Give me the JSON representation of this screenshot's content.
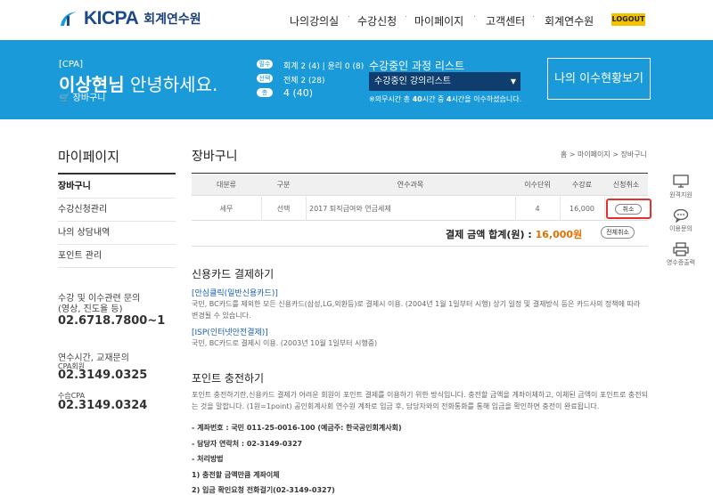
{
  "header": {
    "logo_mark": "KICPA",
    "logo_sub": "회계연수원",
    "nav": [
      "나의강의실",
      "수강신청",
      "마이페이지",
      "고객센터",
      "회계연수원"
    ],
    "logout": "LOGOUT"
  },
  "banner": {
    "tag": "[CPA]",
    "name": "이상현님",
    "greeting": " 안녕하세요.",
    "cart_link": "장바구니",
    "stats": [
      {
        "badge": "필수",
        "text": "회계 2 (4) | 윤리 0 (8)"
      },
      {
        "badge": "선택",
        "text": "전체 2 (28)"
      },
      {
        "badge": "총",
        "text": "4 (40)"
      }
    ],
    "list_title": "수강중인 과정 리스트",
    "select_value": "수강중인 강의리스트",
    "note_prefix": "※의무시간 총 ",
    "note_total": "40",
    "note_mid": "시간 중 ",
    "note_done": "4",
    "note_suffix": "시간을 이수하셨습니다.",
    "history_button": "나의 이수현황보기"
  },
  "sidebar": {
    "title": "마이페이지",
    "items": [
      "장바구니",
      "수강신청관리",
      "나의 상담내역",
      "포인트 관리"
    ],
    "contact1_label1": "수강 및 이수관련 문의",
    "contact1_label2": "(영상, 진도율 등)",
    "contact1_phone": "02.6718.7800~1",
    "contact2_label1": "연수시간, 교재문의",
    "contact2_label2": "CPA회원",
    "contact2_phone": "02.3149.0325",
    "contact3_label": "수습CPA",
    "contact3_phone": "02.3149.0324"
  },
  "main": {
    "title": "장바구니",
    "breadcrumb": "홈 > 마이페이지 > 장바구니",
    "table_headers": [
      "대분류",
      "구분",
      "연수과목",
      "이수단위",
      "수강료",
      "신청취소"
    ],
    "row": {
      "category": "세무",
      "type": "선택",
      "subject": "2017 퇴직급여와 연금세제",
      "units": "4",
      "fee": "16,000",
      "cancel": "취소"
    },
    "total_label": "결제 금액 합계(원) : ",
    "total_amount": "16,000원",
    "all_cancel": "전체취소",
    "card_section_title": "신용카드 결제하기",
    "card_sub1": "[안심클릭(일반신용카드)]",
    "card_text1": "국민, BC카드를 제외한 모든 신용카드(삼성,LG,외환등)로 결제시 이용. (2004년 1월 1일부터 시행) 상기 일정 및 결제방식 등은 카드사의 정책에 따라 변경될 수 있습니다.",
    "card_sub2": "[ISP(인터넷안전결제)]",
    "card_text2": "국민, BC카드로 결제시 이용. (2003년 10월 1일부터 시행중)",
    "point_section_title": "포인트 충전하기",
    "point_text": "포인트 충전하기란,신용카드 결제가 어려운 회원이 포인트 결제를 이용하기 위한 방식입니다. 충전할 금액을 계좌이체하고, 이체된 금액이 포인트로 충전되는 것을 말합니다. (1원=1point) 공인회계사회 연수원 계좌로 입금 후, 담당자와의 전화통화를 통해 입금을 확인하면 충전이 완료됩니다.",
    "account_line": "- 계좌번호 : 국민 011-25-0016-100 (예금주: 한국공인회계사회)",
    "contact_line": "- 담당자 연락처 : 02-3149-0327",
    "process_line": "- 처리방법",
    "step1": "1) 충전할 금액만큼 계좌이체",
    "step2": "2) 입금 확인요청 전화걸기(02-3149-0327)"
  },
  "floating": {
    "remote": "원격지원",
    "inquiry": "이용문의",
    "receipt": "영수증출력"
  },
  "colors": {
    "banner": "#1a9ad9",
    "logout": "#f5c200",
    "highlight": "#e53030",
    "amount": "#e07000"
  }
}
